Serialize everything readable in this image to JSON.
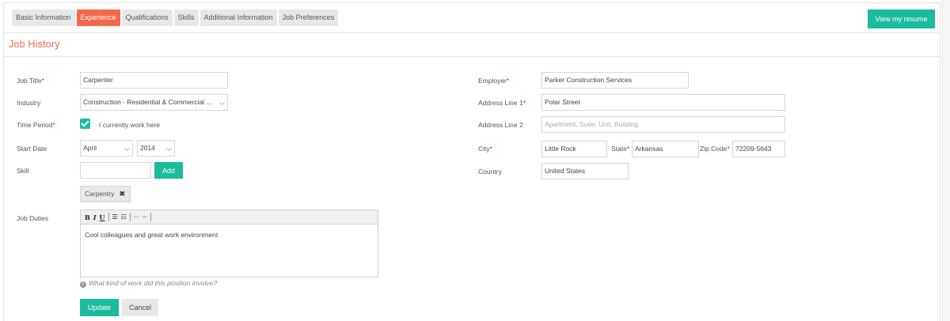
{
  "tabs": [
    {
      "label": "Basic Information"
    },
    {
      "label": "Experience"
    },
    {
      "label": "Qualifications"
    },
    {
      "label": "Skills"
    },
    {
      "label": "Additional Information"
    },
    {
      "label": "Job Preferences"
    }
  ],
  "active_tab": "Experience",
  "view_resume_label": "View my resume",
  "section_title": "Job History",
  "form": {
    "job_title": {
      "label": "Job Title",
      "required_mark": "*",
      "value": "Carpenter"
    },
    "industry": {
      "label": "Industry",
      "value": "Construction - Residential & Commercial ..."
    },
    "time_period": {
      "label": "Time Period",
      "required_mark": "*",
      "checkbox_label": "I currently work here",
      "checked": true
    },
    "start_date": {
      "label": "Start Date",
      "month": "April",
      "year": "2014"
    },
    "skill": {
      "label": "Skill",
      "value": "",
      "add_label": "Add",
      "tags": [
        {
          "label": "Carpentry",
          "remove_glyph": "✖"
        }
      ]
    },
    "job_duties": {
      "label": "Job Duties",
      "value": "Cool colleagues and great work environment",
      "hint": "What kind of work did this position involve?",
      "hint_icon": "i"
    },
    "toolbar": {
      "bold": "B",
      "italic": "I",
      "underline": "U",
      "bullets": "☰",
      "numbers": "☷",
      "link": "⚯",
      "unlink": "⚮"
    },
    "employer": {
      "label": "Employer",
      "required_mark": "*",
      "value": "Parker Construction Services"
    },
    "address1": {
      "label": "Address Line 1",
      "required_mark": "*",
      "value": "Polar Street"
    },
    "address2": {
      "label": "Address Line 2",
      "value": "",
      "placeholder": "Apartment, Suite, Unit, Building"
    },
    "city": {
      "label": "City",
      "required_mark": "*",
      "value": "Little Rock"
    },
    "state": {
      "label": "State",
      "required_mark": "*",
      "value": "Arkansas"
    },
    "zip": {
      "label": "Zip Code",
      "required_mark": "*",
      "value": "72209-5643"
    },
    "country": {
      "label": "Country",
      "value": "United States"
    }
  },
  "actions": {
    "update_label": "Update",
    "cancel_label": "Cancel"
  },
  "colors": {
    "accent": "#f4674b",
    "primary": "#1bbc9b",
    "required": "#e2231a"
  }
}
